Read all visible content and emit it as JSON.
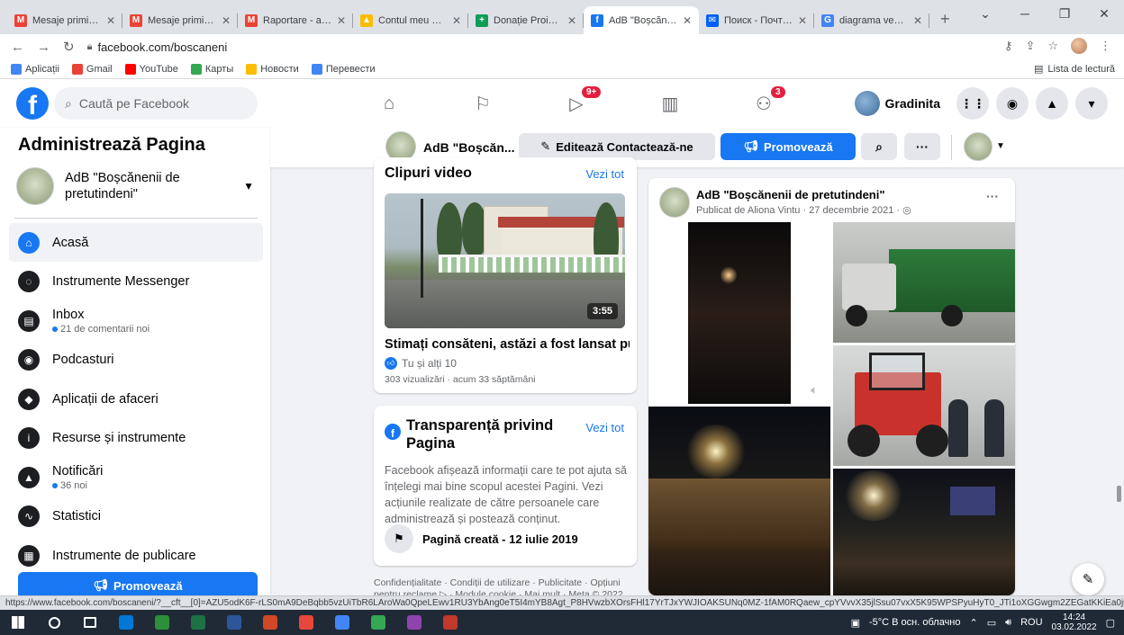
{
  "browser": {
    "tabs": [
      {
        "title": "Mesaje primite (",
        "color": "#ea4335",
        "glyph": "M"
      },
      {
        "title": "Mesaje primite (",
        "color": "#ea4335",
        "glyph": "M"
      },
      {
        "title": "Raportare - asoc",
        "color": "#ea4335",
        "glyph": "M"
      },
      {
        "title": "Contul meu Drive",
        "color": "#fbbc04",
        "glyph": "▲"
      },
      {
        "title": "Donație Proiectul",
        "color": "#0f9d58",
        "glyph": "+"
      },
      {
        "title": "AdB \"Boșcănenii",
        "color": "#1877f2",
        "glyph": "f",
        "active": true
      },
      {
        "title": "Поиск - Почта М",
        "color": "#005ff9",
        "glyph": "✉"
      },
      {
        "title": "diagrama venn -",
        "color": "#4285f4",
        "glyph": "G"
      }
    ],
    "url": "facebook.com/boscaneni",
    "bookmarks": [
      {
        "label": "Aplicații",
        "color": "#4285f4"
      },
      {
        "label": "Gmail",
        "color": "#ea4335"
      },
      {
        "label": "YouTube",
        "color": "#ff0000"
      },
      {
        "label": "Карты",
        "color": "#34a853"
      },
      {
        "label": "Новости",
        "color": "#fbbc04"
      },
      {
        "label": "Перевести",
        "color": "#4285f4"
      }
    ],
    "reading_list": "Lista de lectură",
    "status_url": "https://www.facebook.com/boscaneni/?__cft__[0]=AZU5odK6F-rLS0mA9DeBqbb5vzUiTbR6LAroWa0QpeLEwv1RU3YbAng0eT5I4mYB8Agt_P8HVwzbXOrsFHl17YrTJxYWJIOAKSUNq0MZ-1fAM0RQaew_cpYVvvX35jlSsu07vxX5K95WPSPyuHyT0_JTi1oXGGwgm2ZEGatKKiEa0jnkQlk9hHOy..."
  },
  "fb": {
    "search_placeholder": "Caută pe Facebook",
    "badges": {
      "watch": "9+",
      "groups": "3"
    },
    "profile_name": "Gradinita"
  },
  "admin": {
    "title": "Administrează Pagina",
    "page_name": "AdB \"Boșcănenii de pretutindeni\"",
    "menu": [
      {
        "label": "Acasă",
        "glyph": "⌂",
        "active": true,
        "sub": ""
      },
      {
        "label": "Instrumente Messenger",
        "glyph": "◌",
        "sub": ""
      },
      {
        "label": "Inbox",
        "glyph": "▤",
        "sub": "21 de comentarii noi"
      },
      {
        "label": "Podcasturi",
        "glyph": "◉",
        "sub": ""
      },
      {
        "label": "Aplicații de afaceri",
        "glyph": "◆",
        "sub": ""
      },
      {
        "label": "Resurse și instrumente",
        "glyph": "i",
        "sub": ""
      },
      {
        "label": "Notificări",
        "glyph": "▲",
        "sub": "36 noi"
      },
      {
        "label": "Statistici",
        "glyph": "∿",
        "sub": ""
      },
      {
        "label": "Instrumente de publicare",
        "glyph": "▦",
        "sub": ""
      }
    ],
    "promote": "Promovează"
  },
  "pagebar": {
    "name": "AdB \"Boșcăn...",
    "edit": "Editează Contactează-ne",
    "promote": "Promovează"
  },
  "videos": {
    "heading": "Clipuri video",
    "see_all": "Vezi tot",
    "duration": "3:55",
    "title": "Stimați consăteni, astăzi a fost lansat pu...",
    "likes": "Tu și alți 10",
    "meta": "303 vizualizări · acum 33 săptămâni"
  },
  "transparency": {
    "heading": "Transparență privind Pagina",
    "see_all": "Vezi tot",
    "body": "Facebook afișează informații care te pot ajuta să înțelegi mai bine scopul acestei Pagini. Vezi acțiunile realizate de către persoanele care administrează și postează conținut.",
    "created": "Pagină creată - 12 iulie 2019"
  },
  "footer": "Confidențialitate · Condiții de utilizare · Publicitate · Opțiuni pentru reclame ▷ · Module cookie · Mai mult · Meta © 2022",
  "post": {
    "author": "AdB \"Boșcănenii de pretutindeni\"",
    "meta": "Publicat de Aliona Vintu · 27 decembrie 2021 ·"
  },
  "taskbar": {
    "weather": "-5°C В осн. облачно",
    "lang": "ROU",
    "time": "14:24",
    "date": "03.02.2022",
    "apps": [
      "#0078d7",
      "#2d8f3c",
      "#1e7145",
      "#2b579a",
      "#d24726",
      "#e8473c",
      "#4285f4",
      "#34a853",
      "#8e44ad",
      "#c0392b"
    ]
  }
}
